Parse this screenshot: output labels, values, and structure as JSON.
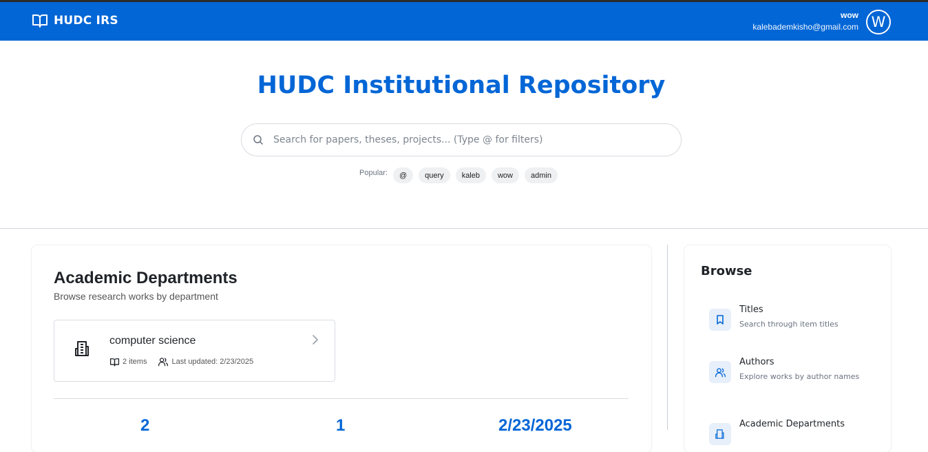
{
  "navbar": {
    "brand": "HUDC IRS",
    "user_name": "wow",
    "user_email": "kalebademkisho@gmail.com",
    "avatar_letter": "W"
  },
  "hero": {
    "title": "HUDC Institutional Repository",
    "search_placeholder": "Search for papers, theses, projects... (Type @ for filters)",
    "popular_label": "Popular:",
    "popular_tags": [
      "@",
      "query",
      "kaleb",
      "wow",
      "admin"
    ]
  },
  "departments": {
    "title": "Academic Departments",
    "subtitle": "Browse research works by department",
    "items": [
      {
        "name": "computer science",
        "items_count": "2 items",
        "last_updated": "Last updated: 2/23/2025"
      }
    ],
    "stats": [
      "2",
      "1",
      "2/23/2025"
    ]
  },
  "browse": {
    "title": "Browse",
    "items": [
      {
        "title": "Titles",
        "desc": "Search through item titles",
        "icon": "bookmark-icon"
      },
      {
        "title": "Authors",
        "desc": "Explore works by author names",
        "icon": "users-icon"
      },
      {
        "title": "Academic Departments",
        "desc": "",
        "icon": "building-icon"
      }
    ]
  },
  "colors": {
    "primary": "#0366d6",
    "chip_bg": "#eef0f2"
  }
}
